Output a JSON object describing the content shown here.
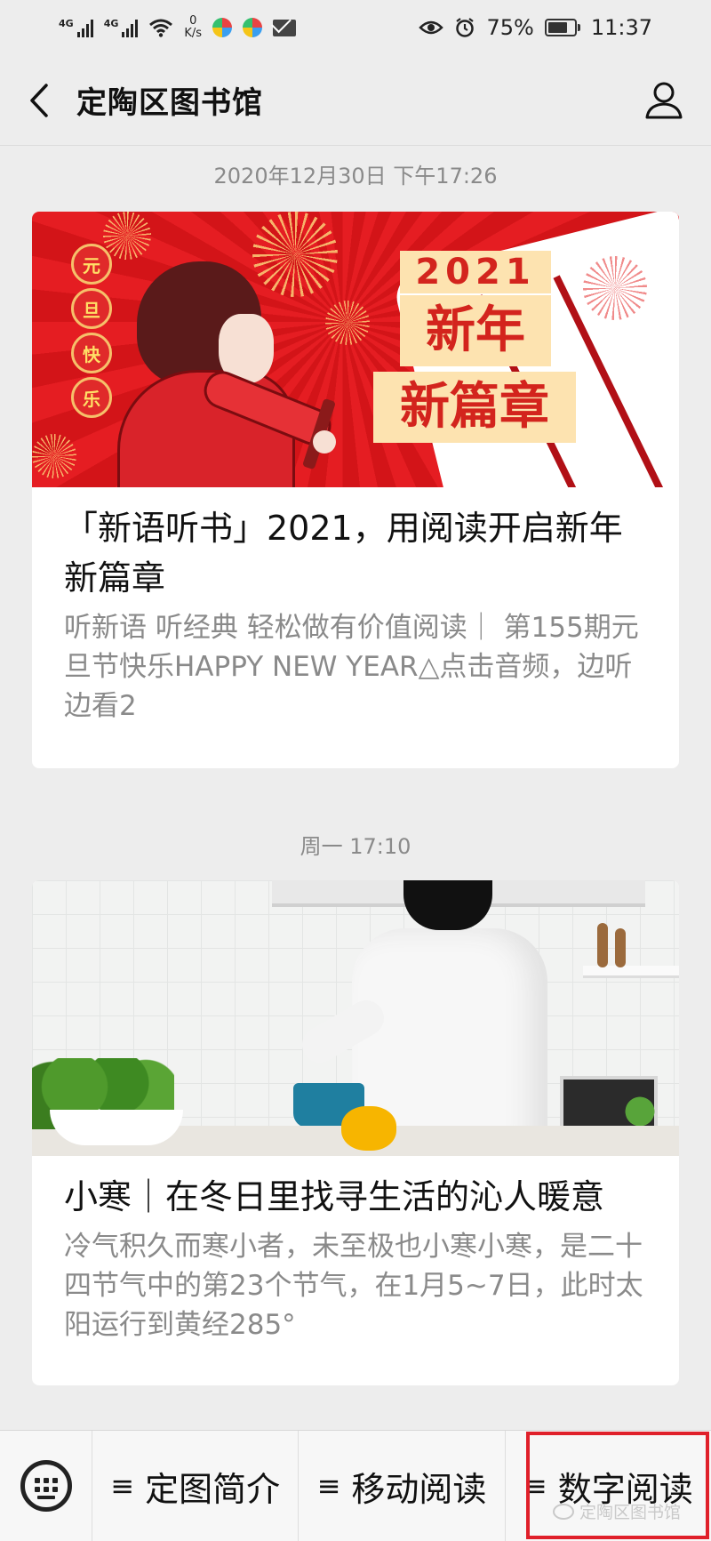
{
  "status_bar": {
    "network_1": "4G",
    "network_2": "4G",
    "speed_value": "0",
    "speed_unit": "K/s",
    "battery": "75%",
    "time": "11:37"
  },
  "header": {
    "title": "定陶区图书馆"
  },
  "feed": [
    {
      "timestamp": "2020年12月30日 下午17:26",
      "cover": {
        "lanterns": [
          "元",
          "旦",
          "快",
          "乐"
        ],
        "year": "2021",
        "line1": "新年",
        "line2": "新篇章"
      },
      "title": "「新语听书」2021，用阅读开启新年新篇章",
      "summary": "听新语  听经典 轻松做有价值阅读｜ 第155期元旦节快乐HAPPY NEW YEAR△点击音频，边听边看2"
    },
    {
      "timestamp": "周一 17:10",
      "title": "小寒｜在冬日里找寻生活的沁人暖意",
      "summary": "冷气积久而寒小者，未至极也小寒小寒，是二十四节气中的第23个节气，在1月5~7日，此时太阳运行到黄经285°"
    }
  ],
  "bottom_menu": {
    "items": [
      {
        "icon": "≡",
        "label": "定图简介"
      },
      {
        "icon": "≡",
        "label": "移动阅读"
      },
      {
        "icon": "≡",
        "label": "数字阅读"
      }
    ],
    "highlight_color": "#e0202a"
  },
  "watermark": "定陶区图书馆"
}
